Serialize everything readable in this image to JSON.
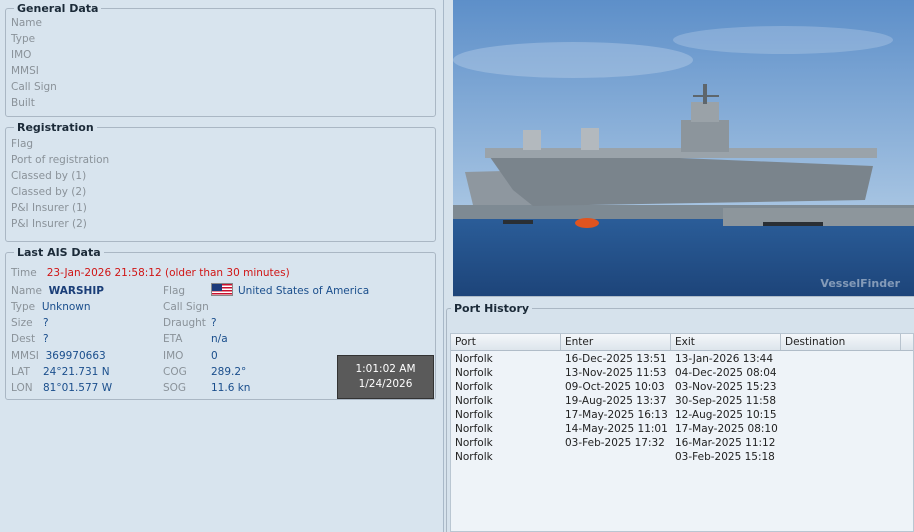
{
  "general": {
    "title": "General Data",
    "fields": [
      "Name",
      "Type",
      "IMO",
      "MMSI",
      "Call Sign",
      "Built"
    ]
  },
  "registration": {
    "title": "Registration",
    "fields": [
      "Flag",
      "Port of registration",
      "Classed by (1)",
      "Classed by (2)",
      "P&I Insurer (1)",
      "P&I Insurer (2)"
    ]
  },
  "ais": {
    "title": "Last AIS Data",
    "time_label": "Time",
    "time_value": "23-Jan-2026 21:58:12 (older than 30 minutes)",
    "name_label": "Name",
    "name_value": "WARSHIP",
    "type_label": "Type",
    "type_value": "Unknown",
    "size_label": "Size",
    "size_value": "?",
    "dest_label": "Dest",
    "dest_value": "?",
    "mmsi_label": "MMSI",
    "mmsi_value": "369970663",
    "lat_label": "LAT",
    "lat_value": "24°21.731 N",
    "lon_label": "LON",
    "lon_value": "81°01.577 W",
    "flag_label": "Flag",
    "flag_value": "United States of America",
    "callsign_label": "Call Sign",
    "callsign_value": "",
    "draught_label": "Draught",
    "draught_value": "?",
    "eta_label": "ETA",
    "eta_value": "n/a",
    "imo_label": "IMO",
    "imo_value": "0",
    "cog_label": "COG",
    "cog_value": "289.2°",
    "sog_label": "SOG",
    "sog_value": "11.6 kn"
  },
  "clock": {
    "time": "1:01:02 AM",
    "date": "1/24/2026"
  },
  "photo": {
    "watermark": "VesselFinder"
  },
  "port_history": {
    "title": "Port History",
    "columns": [
      "Port",
      "Enter",
      "Exit",
      "Destination"
    ],
    "rows": [
      [
        "Norfolk",
        "16-Dec-2025 13:51",
        "13-Jan-2026 13:44",
        ""
      ],
      [
        "Norfolk",
        "13-Nov-2025 11:53",
        "04-Dec-2025 08:04",
        ""
      ],
      [
        "Norfolk",
        "09-Oct-2025 10:03",
        "03-Nov-2025 15:23",
        ""
      ],
      [
        "Norfolk",
        "19-Aug-2025 13:37",
        "30-Sep-2025 11:58",
        ""
      ],
      [
        "Norfolk",
        "17-May-2025 16:13",
        "12-Aug-2025 10:15",
        ""
      ],
      [
        "Norfolk",
        "14-May-2025 11:01",
        "17-May-2025 08:10",
        ""
      ],
      [
        "Norfolk",
        "03-Feb-2025 17:32",
        "16-Mar-2025 11:12",
        ""
      ],
      [
        "Norfolk",
        "",
        "03-Feb-2025 15:18",
        ""
      ]
    ]
  }
}
